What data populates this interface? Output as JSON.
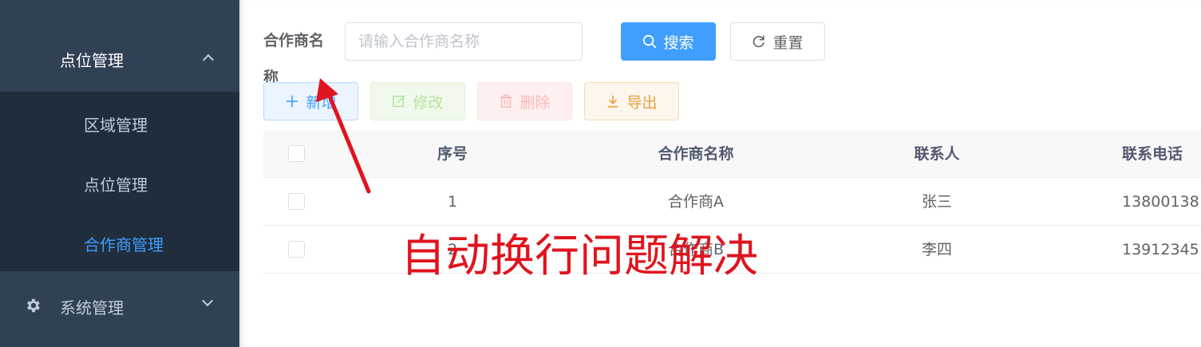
{
  "sidebar": {
    "menu_title": "点位管理",
    "items": [
      {
        "label": "区域管理",
        "active": false
      },
      {
        "label": "点位管理",
        "active": false
      },
      {
        "label": "合作商管理",
        "active": true
      }
    ],
    "system_label": "系统管理",
    "icons": {
      "gear": "gear-icon",
      "expand": "chevron-up-icon",
      "collapse": "chevron-down-icon"
    }
  },
  "search": {
    "label": "合作商名称",
    "placeholder": "请输入合作商名称",
    "value": "",
    "search_label": "搜索",
    "reset_label": "重置"
  },
  "toolbar": {
    "add_label": "新增",
    "edit_label": "修改",
    "delete_label": "删除",
    "export_label": "导出"
  },
  "table": {
    "headers": {
      "index": "序号",
      "name": "合作商名称",
      "contact": "联系人",
      "phone": "联系电话"
    },
    "rows": [
      {
        "index": "1",
        "name": "合作商A",
        "contact": "张三",
        "phone": "13800138"
      },
      {
        "index": "2",
        "name": "合作商B",
        "contact": "李四",
        "phone": "13912345"
      }
    ]
  },
  "annotation": {
    "text": "自动换行问题解决"
  },
  "colors": {
    "sidebar_bg": "#304156",
    "submenu_bg": "#1f2d3d",
    "primary": "#409eff",
    "annotation": "#e0141e"
  }
}
